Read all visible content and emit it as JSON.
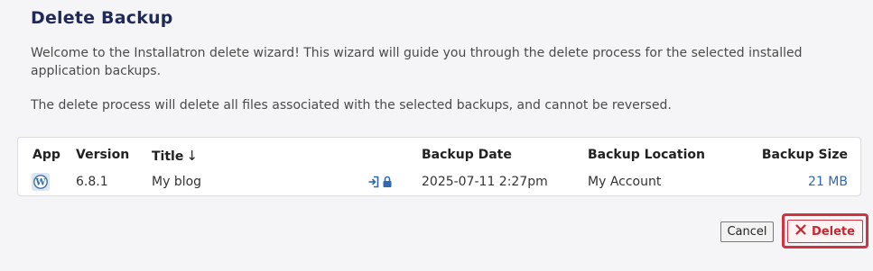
{
  "header": {
    "title": "Delete Backup"
  },
  "intro_text": "Welcome to the Installatron delete wizard! This wizard will guide you through the delete process for the selected installed application backups.",
  "note_text": "The delete process will delete all files associated with the selected backups, and cannot be reversed.",
  "table": {
    "headers": {
      "app": "App",
      "version": "Version",
      "title": "Title",
      "title_sort": "↓",
      "backup_date": "Backup Date",
      "backup_location": "Backup Location",
      "backup_size": "Backup Size"
    },
    "rows": [
      {
        "app_icon": "wordpress-icon",
        "version": "6.8.1",
        "title": "My blog",
        "status_icons": [
          "sign-in-icon",
          "lock-icon"
        ],
        "backup_date": "2025-07-11 2:27pm",
        "backup_location": "My Account",
        "backup_size": "21 MB"
      }
    ]
  },
  "actions": {
    "cancel_label": "Cancel",
    "delete_label": "Delete",
    "delete_icon": "x-icon"
  },
  "colors": {
    "title": "#1f2a5a",
    "link": "#2f68b0",
    "danger": "#d33340",
    "background": "#f5f5f7"
  }
}
